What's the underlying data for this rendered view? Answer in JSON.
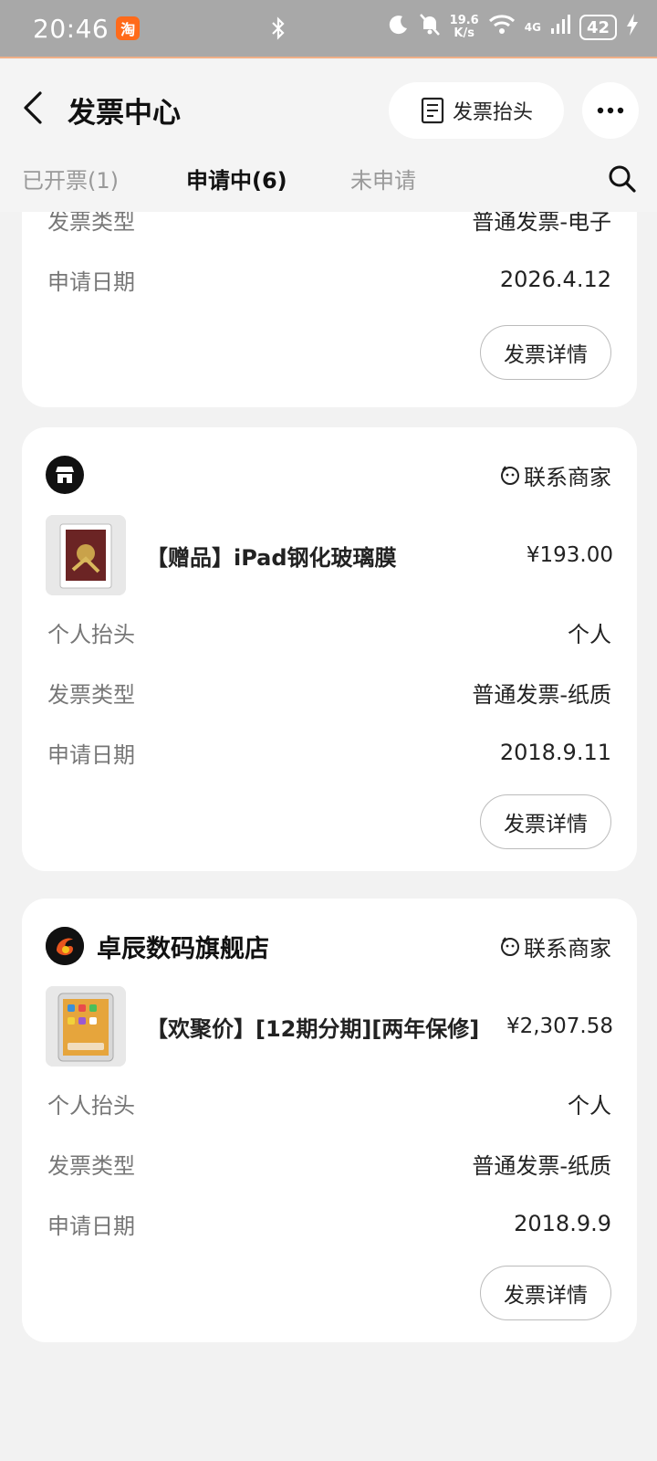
{
  "status_bar": {
    "time": "20:46",
    "app_badge": "淘",
    "net_speed_top": "19.6",
    "net_speed_bottom": "K/s",
    "network": "4G",
    "battery": "42"
  },
  "header": {
    "title": "发票中心",
    "invoice_header_label": "发票抬头"
  },
  "tabs": [
    {
      "label": "已开票(1)"
    },
    {
      "label": "申请中(6)"
    },
    {
      "label": "未申请"
    }
  ],
  "cards": [
    {
      "rows": [
        {
          "label": "发票类型",
          "value": "普通发票-电子"
        },
        {
          "label": "申请日期",
          "value": "2026.4.12"
        }
      ],
      "detail_label": "发票详情"
    },
    {
      "shop_name": "",
      "contact_label": "联系商家",
      "product_title": "【赠品】iPad钢化玻璃膜",
      "price": "¥193.00",
      "rows": [
        {
          "label": "个人抬头",
          "value": "个人"
        },
        {
          "label": "发票类型",
          "value": "普通发票-纸质"
        },
        {
          "label": "申请日期",
          "value": "2018.9.11"
        }
      ],
      "detail_label": "发票详情"
    },
    {
      "shop_name": "卓辰数码旗舰店",
      "contact_label": "联系商家",
      "product_title": "【欢聚价】[12期分期][两年保修]",
      "price": "¥2,307.58",
      "rows": [
        {
          "label": "个人抬头",
          "value": "个人"
        },
        {
          "label": "发票类型",
          "value": "普通发票-纸质"
        },
        {
          "label": "申请日期",
          "value": "2018.9.9"
        }
      ],
      "detail_label": "发票详情"
    }
  ],
  "colors": {
    "status_bar_bg": "#a8a8a8",
    "page_bg": "#f2f2f2",
    "card_bg": "#ffffff",
    "app_badge": "#ff6a1a"
  },
  "icons": [
    "back-icon",
    "list-icon",
    "more-icon",
    "search-icon",
    "store-icon",
    "shop-logo-icon",
    "customer-service-icon"
  ]
}
